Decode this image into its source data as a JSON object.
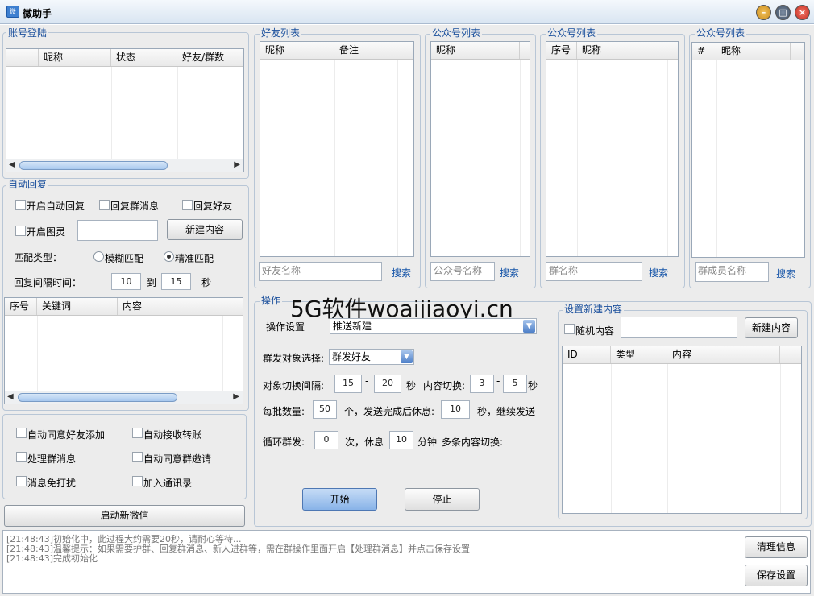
{
  "window": {
    "title": "微助手",
    "icon": "app-icon",
    "controls": [
      "minimize-icon",
      "maximize-icon",
      "close-icon"
    ]
  },
  "account": {
    "title": "账号登陆",
    "columns": [
      "昵称",
      "状态",
      "好友/群数"
    ]
  },
  "auto_reply": {
    "title": "自动回复",
    "auto_reply_label": "开启自动回复",
    "reply_group_label": "回复群消息",
    "reply_friend_label": "回复好友",
    "tuling_label": "开启图灵",
    "new_content_button": "新建内容",
    "match_type_label": "匹配类型：",
    "fuzzy_label": "模糊匹配",
    "exact_label": "精准匹配",
    "interval_label": "回复间隔时间：",
    "interval_from": "10",
    "to_label": "到",
    "interval_to": "15",
    "seconds_label": "秒",
    "columns": [
      "序号",
      "关键词",
      "内容"
    ]
  },
  "options": {
    "auto_accept_friend": "自动同意好友添加",
    "auto_receive_transfer": "自动接收转账",
    "handle_group_msg": "处理群消息",
    "auto_accept_group_invite": "自动同意群邀请",
    "mute_msg": "消息免打扰",
    "add_contacts": "加入通讯录",
    "start_wechat_button": "启动新微信"
  },
  "friends": {
    "title": "好友列表",
    "columns": [
      "昵称",
      "备注"
    ],
    "search_placeholder": "好友名称",
    "search_label": "搜索"
  },
  "official1": {
    "title": "公众号列表",
    "columns": [
      "昵称"
    ],
    "search_placeholder": "公众号名称",
    "search_label": "搜索"
  },
  "official2": {
    "title": "公众号列表",
    "columns": [
      "序号",
      "昵称"
    ],
    "search_placeholder": "群名称",
    "search_label": "搜索"
  },
  "official3": {
    "title": "公众号列表",
    "columns": [
      "#",
      "昵称"
    ],
    "search_placeholder": "群成员名称",
    "search_label": "搜索"
  },
  "operation": {
    "title": "操作",
    "settings_label": "操作设置",
    "settings_value": "推送新建",
    "target_label": "群发对象选择:",
    "target_value": "群发好友",
    "switch_interval_label": "对象切换间隔:",
    "switch_from": "15",
    "switch_to": "20",
    "seconds": "秒",
    "content_switch_label": "内容切换:",
    "content_from": "3",
    "content_to": "5",
    "batch_label": "每批数量:",
    "batch_value": "50",
    "batch_rest_label": "个，发送完成后休息:",
    "rest_value": "10",
    "continue_label": "秒，继续发送",
    "loop_label": "循环群发:",
    "loop_value": "0",
    "loop_rest_label": "次，休息",
    "loop_rest_value": "10",
    "minute_label": "分钟",
    "multi_switch_label": "多条内容切换:",
    "start_button": "开始",
    "stop_button": "停止",
    "dash": "-"
  },
  "new_content": {
    "title": "设置新建内容",
    "random_label": "随机内容",
    "new_button": "新建内容",
    "columns": [
      "ID",
      "类型",
      "内容"
    ]
  },
  "log": {
    "lines": [
      "[21:48:43]初始化中，此过程大约需要20秒，请耐心等待...",
      "[21:48:43]温馨提示：如果需要护群、回复群消息、新人进群等，需在群操作里面开启【处理群消息】并点击保存设置",
      "[21:48:43]完成初始化"
    ],
    "clear_button": "清理信息",
    "save_button": "保存设置"
  },
  "watermark": "5G软件woaijiaoyi.cn"
}
